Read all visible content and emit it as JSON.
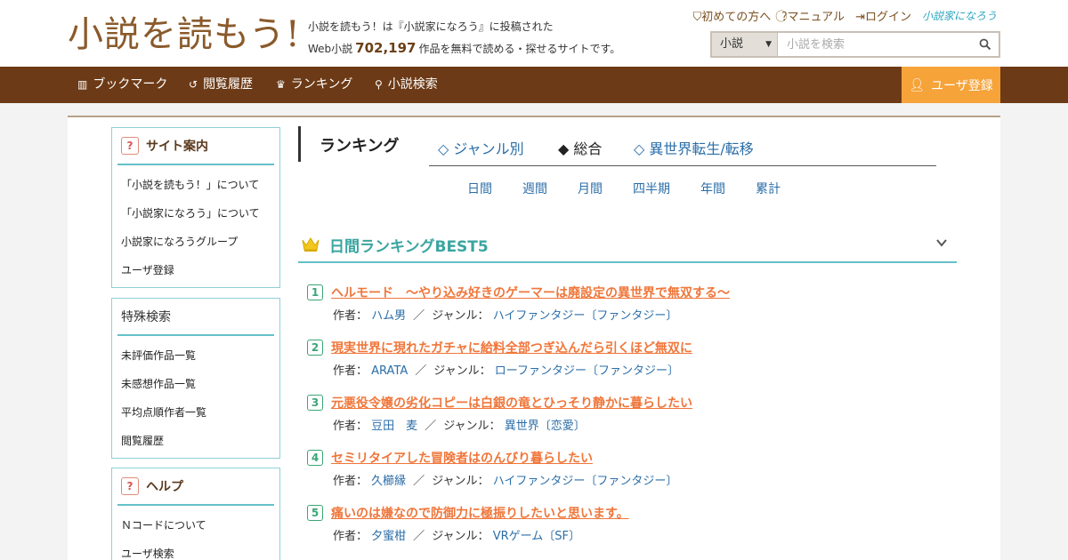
{
  "header": {
    "logo": "小説を読もう!",
    "tagline_line1": "小説を読もう！は『小説家になろう』に投稿された",
    "tagline_prefix": "Web小説",
    "work_count": "702,197",
    "tagline_suffix": "作品を無料で読める・探せるサイトです。",
    "links": [
      "初めての方へ",
      "マニュアル",
      "ログイン"
    ],
    "narou_logo": "小説家になろう"
  },
  "search": {
    "category": "小説",
    "placeholder": "小説を検索"
  },
  "nav": {
    "items": [
      "ブックマーク",
      "閲覧履歴",
      "ランキング",
      "小説検索"
    ],
    "register": "ユーザ登録"
  },
  "sidebar": {
    "site_guide": {
      "title": "サイト案内",
      "items": [
        "「小説を読もう！」について",
        "「小説家になろう」について",
        "小説家になろうグループ",
        "ユーザ登録"
      ]
    },
    "special_search": {
      "title": "特殊検索",
      "items": [
        "未評価作品一覧",
        "未感想作品一覧",
        "平均点順作者一覧",
        "閲覧履歴"
      ]
    },
    "help": {
      "title": "ヘルプ",
      "items": [
        "Ｎコードについて",
        "ユーザ検索"
      ]
    }
  },
  "ranking": {
    "title": "ランキング",
    "tabs": [
      "◇ ジャンル別",
      "◆ 総合",
      "◇ 異世界転生/転移"
    ],
    "periods": [
      "日間",
      "週間",
      "月間",
      "四半期",
      "年間",
      "累計"
    ],
    "best_title": "日間ランキングBEST5",
    "author_label": "作者：",
    "genre_label": "ジャンル：",
    "items": [
      {
        "rank": "1",
        "title": "ヘルモード　～やり込み好きのゲーマーは廃設定の異世界で無双する～",
        "author": "ハム男",
        "genre": "ハイファンタジー〔ファンタジー〕"
      },
      {
        "rank": "2",
        "title": "現実世界に現れたガチャに給料全部つぎ込んだら引くほど無双に",
        "author": "ARATA",
        "genre": "ローファンタジー〔ファンタジー〕"
      },
      {
        "rank": "3",
        "title": "元悪役令嬢の劣化コピーは白銀の竜とひっそり静かに暮らしたい",
        "author": "豆田　麦",
        "genre": "異世界〔恋愛〕"
      },
      {
        "rank": "4",
        "title": "セミリタイアした冒険者はのんびり暮らしたい",
        "author": "久櫛縁",
        "genre": "ハイファンタジー〔ファンタジー〕"
      },
      {
        "rank": "5",
        "title": "痛いのは嫌なので防御力に極振りしたいと思います。",
        "author": "夕蜜柑",
        "genre": "VRゲーム〔SF〕"
      }
    ]
  },
  "colors": {
    "brown": "#6c3a16",
    "orange": "#f6a33a",
    "teal": "#65c0c8",
    "title_orange": "#f0763a",
    "link_blue": "#2b6ea8"
  }
}
